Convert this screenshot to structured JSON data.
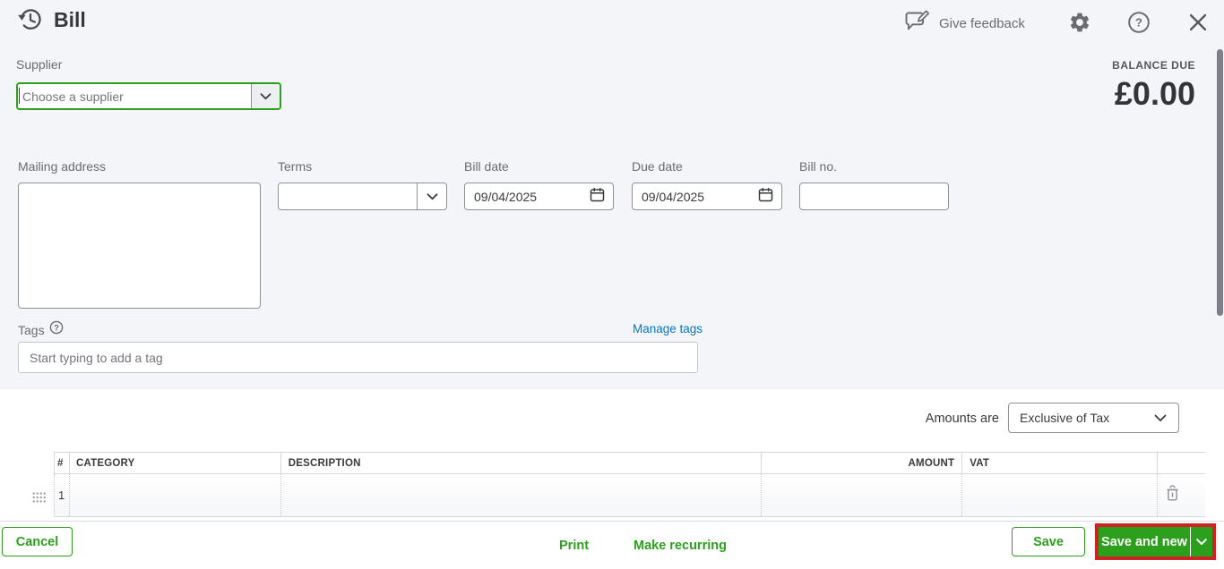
{
  "window": {
    "title": "Bill"
  },
  "header": {
    "give_feedback_label": "Give feedback"
  },
  "supplier": {
    "label": "Supplier",
    "placeholder": "Choose a supplier"
  },
  "balance": {
    "label": "BALANCE DUE",
    "amount": "£0.00"
  },
  "fields": {
    "mailing_address_label": "Mailing address",
    "terms_label": "Terms",
    "bill_date_label": "Bill date",
    "bill_date_value": "09/04/2025",
    "due_date_label": "Due date",
    "due_date_value": "09/04/2025",
    "bill_no_label": "Bill no."
  },
  "tags": {
    "label": "Tags",
    "manage_link": "Manage tags",
    "placeholder": "Start typing to add a tag"
  },
  "amounts": {
    "label": "Amounts are",
    "selected": "Exclusive of Tax"
  },
  "table": {
    "headers": {
      "num": "#",
      "category": "CATEGORY",
      "description": "DESCRIPTION",
      "amount": "AMOUNT",
      "vat": "VAT"
    },
    "rows": [
      {
        "num": "1"
      }
    ]
  },
  "footer": {
    "cancel": "Cancel",
    "print": "Print",
    "make_recurring": "Make recurring",
    "save": "Save",
    "save_and_new": "Save and new"
  },
  "colors": {
    "accent_green": "#2ca01c",
    "link_blue": "#0077c5",
    "annotation_red": "#cf2323",
    "text_dark": "#393a3d",
    "text_grey": "#6b6c72",
    "section_bg": "#f4f5f8"
  }
}
